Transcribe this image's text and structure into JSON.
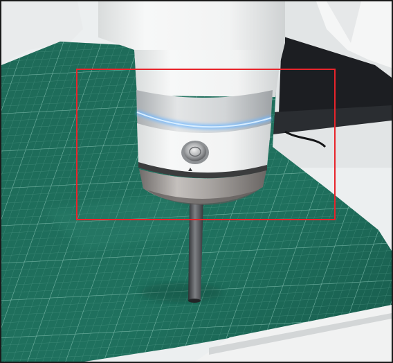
{
  "image": {
    "description_free": true,
    "colors": {
      "cutting_mat": "#1f6e5c",
      "cutting_mat_dark": "#16584a",
      "grid_line": "#6fb3a3",
      "wall": "#eceff0",
      "robot_body": "#f3f4f4",
      "aluminium_ring": "#c9ccce",
      "led_ring": "#5aa9ff",
      "steel_flange": "#9b9795",
      "probe": "#4b4d50",
      "laptop": "#1c1e22",
      "highlight_box": "#e8242b"
    },
    "icons": [
      "button-icon",
      "arrow-marker-icon"
    ]
  }
}
